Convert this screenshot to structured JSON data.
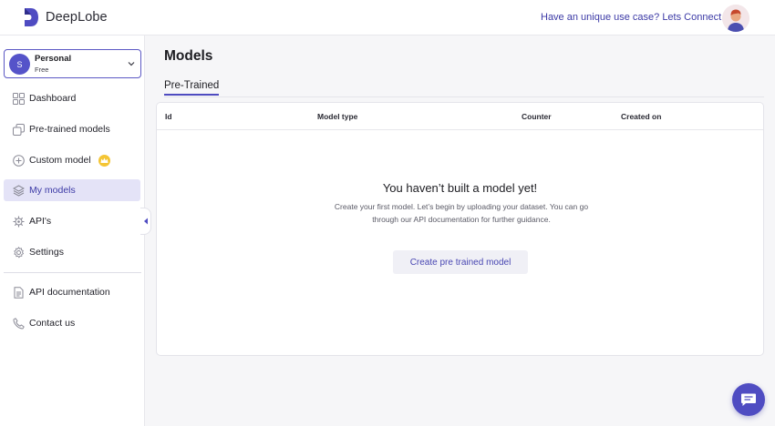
{
  "app": {
    "brand": "DeepLobe",
    "brand_color": "#4f4cc2"
  },
  "header": {
    "connect_link": "Have an unique use case? Lets Connect",
    "user_avatar_icon": "user-avatar"
  },
  "account": {
    "initial": "S",
    "name": "Personal",
    "plan": "Free"
  },
  "sidebar": {
    "items": [
      {
        "label": "Dashboard",
        "icon": "grid-icon"
      },
      {
        "label": "Pre-trained models",
        "icon": "cube-icon"
      },
      {
        "label": "Custom model",
        "icon": "plus-circle-icon"
      },
      {
        "label": "My models",
        "icon": "layers-icon",
        "active": true
      },
      {
        "label": "API's",
        "icon": "api-gear-icon"
      },
      {
        "label": "Settings",
        "icon": "gear-icon"
      },
      {
        "label": "API documentation",
        "icon": "document-icon"
      },
      {
        "label": "Contact us",
        "icon": "phone-icon"
      }
    ]
  },
  "main": {
    "title": "Models",
    "tabs": [
      {
        "label": "Pre-Trained",
        "active": true
      }
    ],
    "table": {
      "columns": [
        "Id",
        "Model type",
        "Counter",
        "Created on"
      ],
      "rows": []
    },
    "empty_state": {
      "title": "You haven’t built a model yet!",
      "description": "Create your first model. Let’s begin by uploading your dataset. You can go through our API documentation for further guidance.",
      "button": "Create pre trained model"
    }
  }
}
